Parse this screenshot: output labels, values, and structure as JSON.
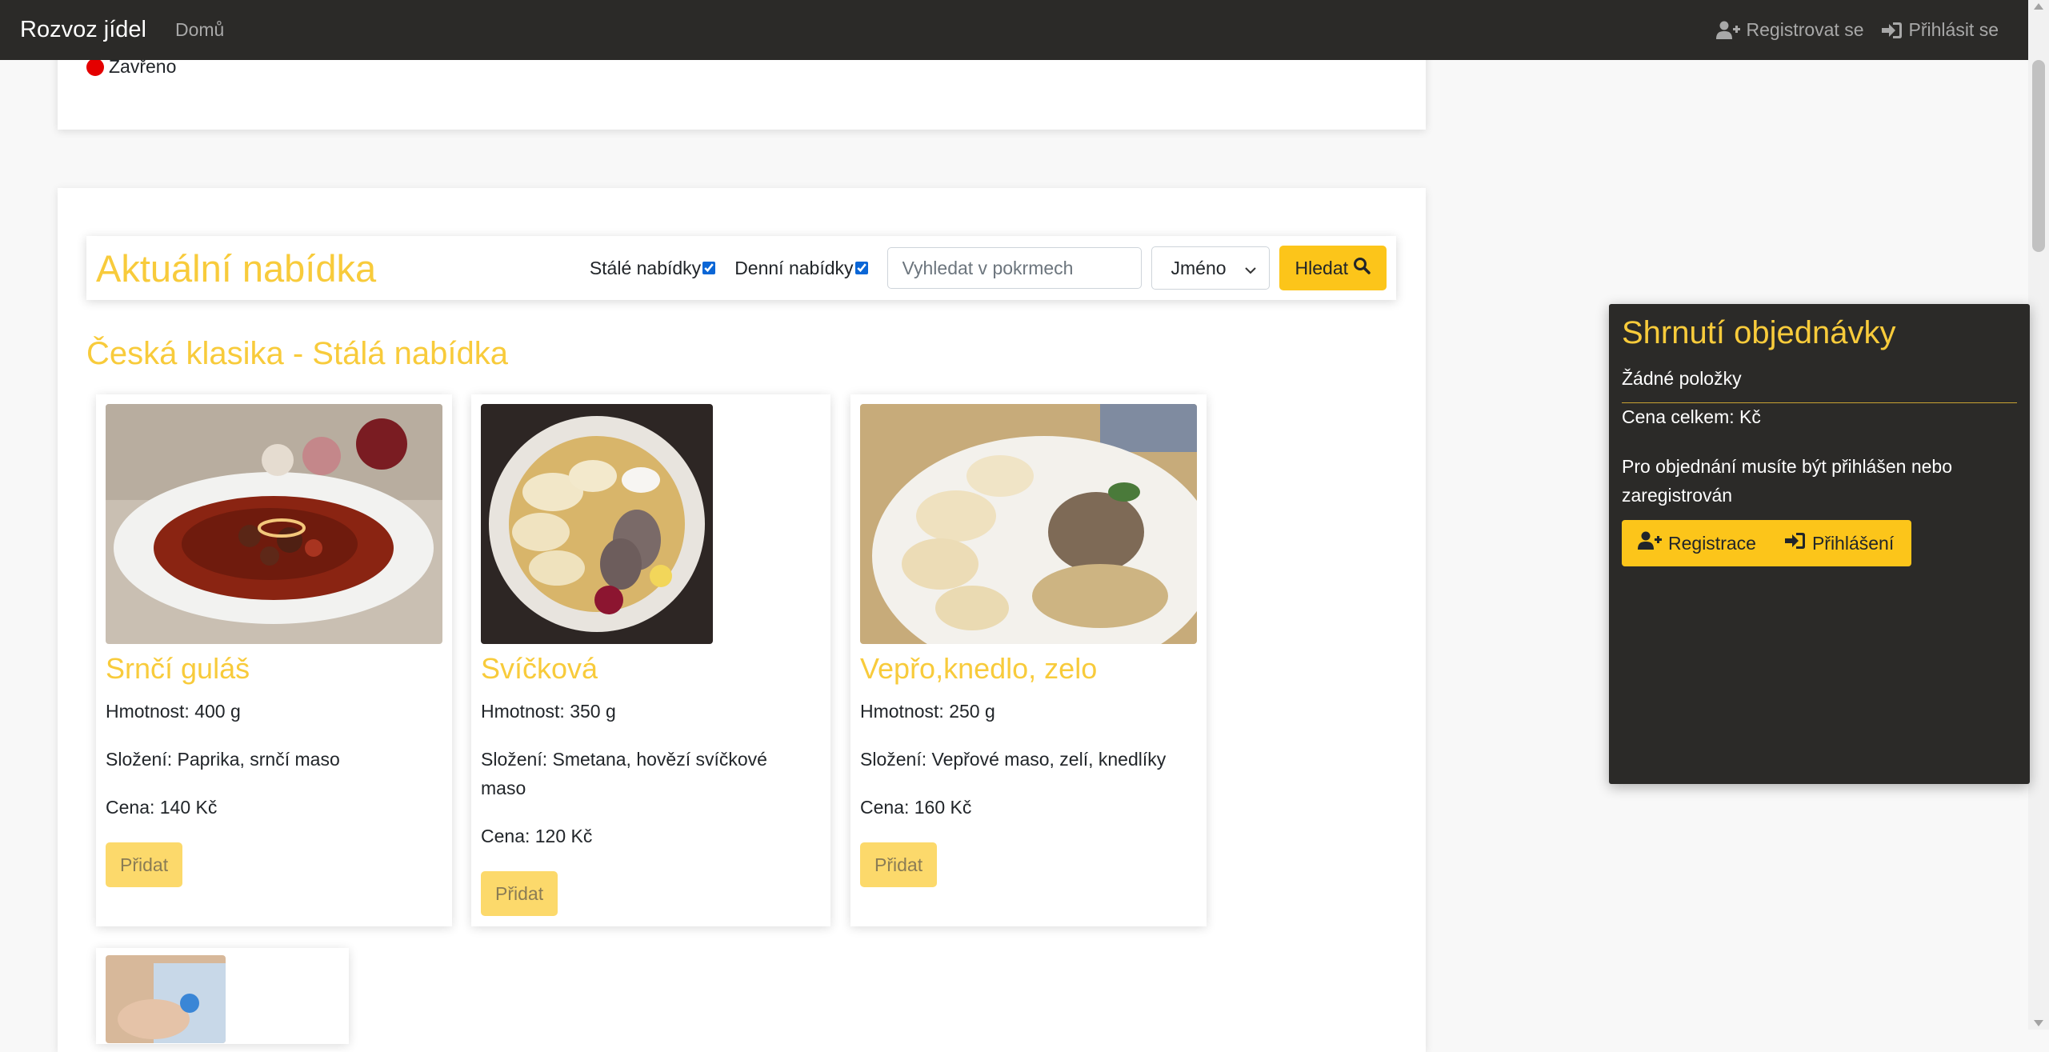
{
  "navbar": {
    "brand": "Rozvoz jídel",
    "home": "Domů",
    "register": "Registrovat se",
    "login": "Přihlásit se"
  },
  "status": {
    "text": "Zavřeno",
    "color": "#e40000"
  },
  "menu": {
    "title": "Aktuální nabídka",
    "filter_permanent": "Stálé nabídky",
    "filter_daily": "Denní nabídky",
    "search_placeholder": "Vyhledat v pokrmech",
    "sort_selected": "Jméno",
    "search_button": "Hledat"
  },
  "section": {
    "title": "Česká klasika - Stálá nabídka"
  },
  "dishes": [
    {
      "name": "Srnčí guláš",
      "weight": "Hmotnost: 400 g",
      "ingredients": "Složení: Paprika, srnčí maso",
      "price": "Cena: 140 Kč",
      "add": "Přidat"
    },
    {
      "name": "Svíčková",
      "weight": "Hmotnost: 350 g",
      "ingredients": "Složení: Smetana, hovězí svíčkové maso",
      "price": "Cena: 120 Kč",
      "add": "Přidat"
    },
    {
      "name": "Vepřo,knedlo, zelo",
      "weight": "Hmotnost: 250 g",
      "ingredients": "Složení: Vepřové maso, zelí, knedlíky",
      "price": "Cena: 160 Kč",
      "add": "Přidat"
    }
  ],
  "summary": {
    "title": "Shrnutí objednávky",
    "empty": "Žádné položky",
    "total": "Cena celkem: Kč",
    "note": "Pro objednání musíte být přihlášen nebo zaregistrován",
    "register": "Registrace",
    "login": "Přihlášení"
  },
  "colors": {
    "accent": "#fcc51a",
    "title": "#f8cb3b",
    "navbar": "#2b2a28"
  }
}
